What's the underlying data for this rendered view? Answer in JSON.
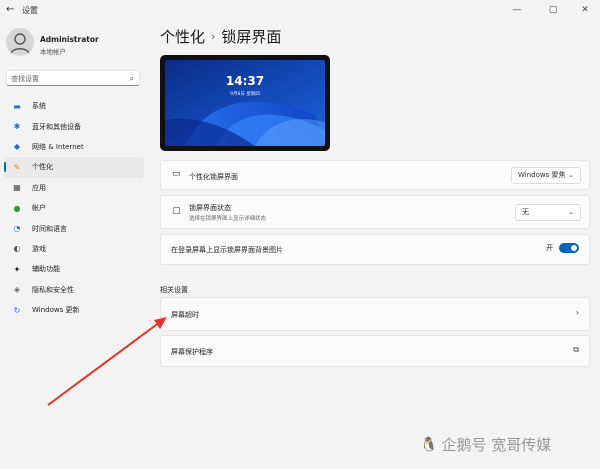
{
  "window": {
    "title": "设置",
    "back_icon": "←",
    "minimize": "—",
    "maximize": "▢",
    "close": "✕"
  },
  "profile": {
    "name": "Administrator",
    "account": "本地帐户"
  },
  "search": {
    "placeholder": "查找设置"
  },
  "sidebar": {
    "items": [
      {
        "label": "系统",
        "icon": "▬",
        "color": "#1f6fd1"
      },
      {
        "label": "蓝牙和其他设备",
        "icon": "✱",
        "color": "#1f6fd1"
      },
      {
        "label": "网络 & Internet",
        "icon": "◆",
        "color": "#1f6fd1"
      },
      {
        "label": "个性化",
        "icon": "✎",
        "color": "#d9822b"
      },
      {
        "label": "应用",
        "icon": "▦",
        "color": "#4a4a4a"
      },
      {
        "label": "帐户",
        "icon": "●",
        "color": "#2e9a48"
      },
      {
        "label": "时间和语言",
        "icon": "◔",
        "color": "#1f6fd1"
      },
      {
        "label": "游戏",
        "icon": "◐",
        "color": "#555555"
      },
      {
        "label": "辅助功能",
        "icon": "✦",
        "color": "#1a1a1a"
      },
      {
        "label": "隐私和安全性",
        "icon": "◈",
        "color": "#666666"
      },
      {
        "label": "Windows 更新",
        "icon": "↻",
        "color": "#1f6fd1"
      }
    ]
  },
  "header": {
    "parent": "个性化",
    "separator": "›",
    "current": "锁屏界面"
  },
  "preview": {
    "time": "14:37",
    "date": "9月8日 星期四"
  },
  "settings": {
    "personalize": {
      "label": "个性化锁屏界面",
      "value": "Windows 聚焦"
    },
    "status": {
      "label": "锁屏界面状态",
      "sublabel": "选择在锁屏界面上显示详细状态",
      "value": "无"
    },
    "background": {
      "label": "在登录屏幕上显示锁屏界面背景图片",
      "toggle_text": "开",
      "toggle_on": true
    }
  },
  "related": {
    "title": "相关设置",
    "items": [
      {
        "label": "屏幕超时",
        "arrow": "›"
      },
      {
        "label": "屏幕保护程序",
        "arrow": "⧉"
      }
    ]
  },
  "watermark": {
    "icon": "🐧",
    "text": "企鹅号 宽哥传媒"
  },
  "colors": {
    "accent": "#0067c0",
    "annotation": "#e53224"
  }
}
